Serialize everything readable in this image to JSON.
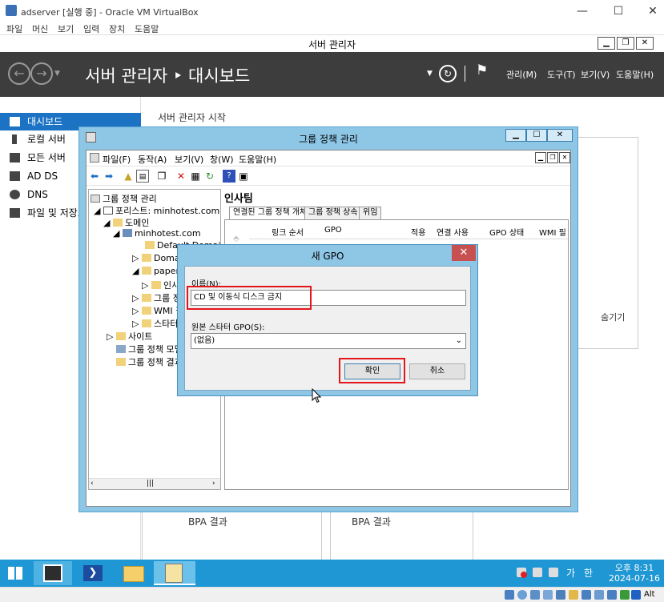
{
  "vbox": {
    "title": "adserver [실행 중] - Oracle VM VirtualBox",
    "menu": [
      "파일",
      "머신",
      "보기",
      "입력",
      "장치",
      "도움말"
    ]
  },
  "server_manager": {
    "title": "서버 관리자",
    "breadcrumb": "서버 관리자 ‣ 대시보드",
    "menus": [
      "관리(M)",
      "도구(T)",
      "보기(V)",
      "도움말(H)"
    ],
    "sidebar": [
      {
        "label": "대시보드",
        "icon": "dashboard-icon",
        "active": true
      },
      {
        "label": "로컬 서버",
        "icon": "server-icon"
      },
      {
        "label": "모든 서버",
        "icon": "servers-icon"
      },
      {
        "label": "AD DS",
        "icon": "ad-ds-icon"
      },
      {
        "label": "DNS",
        "icon": "dns-icon"
      },
      {
        "label": "파일 및 저장소",
        "icon": "file-storage-icon"
      }
    ],
    "main": {
      "heading": "서버 관리자 시작",
      "hide_label": "숨기기",
      "bpa_left": "BPA 결과",
      "bpa_right": "BPA 결과"
    }
  },
  "gpmc": {
    "title": "그룹 정책 관리",
    "menu": [
      "파일(F)",
      "동작(A)",
      "보기(V)",
      "창(W)",
      "도움말(H)"
    ],
    "tree": {
      "root": "그룹 정책 관리",
      "forest": "포리스트: minhotest.com",
      "domains": "도메인",
      "domain": "minhotest.com",
      "default_policy": "Default Domain P",
      "domain_controllers": "Domain",
      "paperco": "paperco",
      "insa": "인사",
      "group_policy_objects": "그룹 정",
      "wmi_filters": "WMI 필",
      "starter": "스타터 G",
      "sites": "사이트",
      "modeling": "그룹 정책 모델",
      "results": "그룹 정책 결과"
    },
    "right": {
      "heading": "인사팀",
      "tabs": [
        "연결된 그룹 정책 개체",
        "그룹 정책 상속",
        "위임"
      ],
      "columns": [
        "링크 순서",
        "GPO",
        "적용",
        "연결 사용",
        "GPO 상태",
        "WMI 필"
      ]
    }
  },
  "dialog": {
    "title": "새 GPO",
    "name_label": "이름(N):",
    "name_value": "CD 및 이동식 디스크 금지",
    "source_label": "원본 스타터 GPO(S):",
    "source_value": "(없음)",
    "ok": "확인",
    "cancel": "취소"
  },
  "taskbar": {
    "ime_lang": "가",
    "ime_mode": "한",
    "time": "오후 8:31",
    "date": "2024-07-16"
  },
  "vbox_status": {
    "hostkey": "Alt"
  },
  "colors": {
    "accent": "#1c73c4",
    "header_bg": "#3d3d3d",
    "taskbar": "#1f97d4",
    "highlight": "#e3161c"
  }
}
